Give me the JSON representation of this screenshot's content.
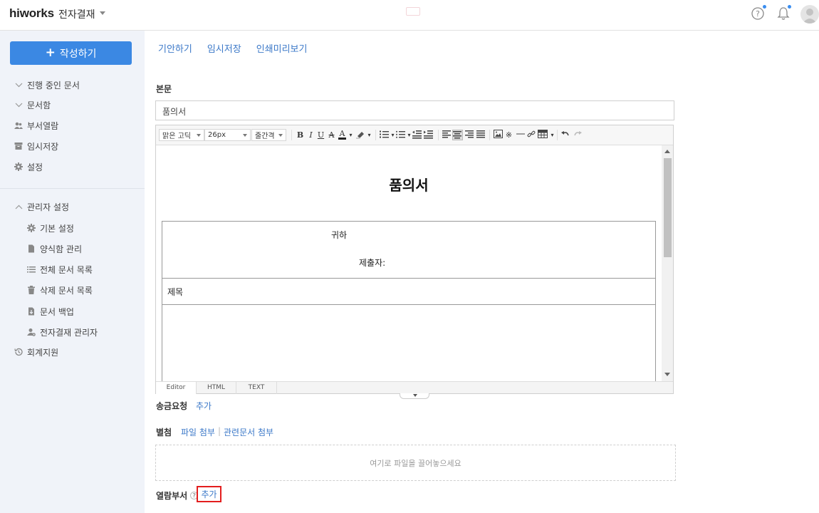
{
  "header": {
    "logo": "hiworks",
    "app_title": "전자결재"
  },
  "sidebar": {
    "write_button": "작성하기",
    "items": [
      {
        "label": "진행 중인 문서",
        "icon": "chevron-down-icon"
      },
      {
        "label": "문서함",
        "icon": "chevron-down-icon"
      },
      {
        "label": "부서열람",
        "icon": "users-icon"
      },
      {
        "label": "임시저장",
        "icon": "archive-icon"
      },
      {
        "label": "설정",
        "icon": "gear-icon"
      }
    ],
    "admin": {
      "label": "관리자 설정",
      "icon": "chevron-up-icon",
      "items": [
        {
          "label": "기본 설정",
          "icon": "gear-icon"
        },
        {
          "label": "양식함 관리",
          "icon": "document-icon"
        },
        {
          "label": "전체 문서 목록",
          "icon": "list-icon"
        },
        {
          "label": "삭제 문서 목록",
          "icon": "trash-icon"
        },
        {
          "label": "문서 백업",
          "icon": "download-doc-icon"
        },
        {
          "label": "전자결재 관리자",
          "icon": "user-gear-icon"
        }
      ]
    },
    "accounting": {
      "label": "회계지원",
      "icon": "history-icon"
    }
  },
  "main": {
    "actions": [
      "기안하기",
      "임시저장",
      "인쇄미리보기"
    ],
    "body_label": "본문",
    "title_value": "품의서",
    "toolbar": {
      "font_family": "맑은 고딕",
      "font_size": "26px",
      "line_height": "줄간격"
    },
    "document": {
      "heading": "품의서",
      "recipient": "귀하",
      "submitter": "제출자:",
      "subject_label": "제목"
    },
    "mode_tabs": [
      "Editor",
      "HTML",
      "TEXT"
    ],
    "payment": {
      "label": "송금요청",
      "add": "추가"
    },
    "attach": {
      "label": "별첨",
      "file": "파일 첨부",
      "sep": "|",
      "related": "관련문서 첨부"
    },
    "dropzone_text": "여기로 파일을 끌어놓으세요",
    "viewers": {
      "label": "열람부서",
      "help": "?",
      "add": "추가"
    }
  }
}
